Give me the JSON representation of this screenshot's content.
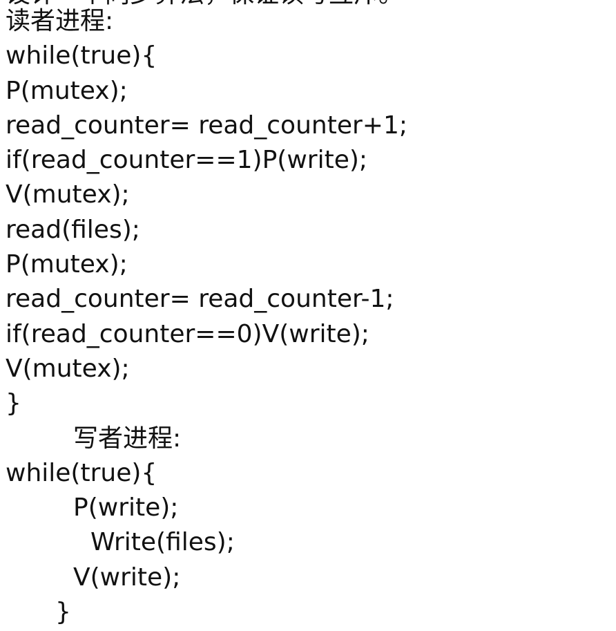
{
  "cut_off_header": "设计一个同步算法，保证读写互斥。",
  "reader": {
    "title": "读者进程:",
    "lines": [
      "while(true){",
      "P(mutex);",
      "read_counter= read_counter+1;",
      "if(read_counter==1)P(write);",
      "V(mutex);",
      "read(files);",
      "P(mutex);",
      "read_counter= read_counter-1;",
      "if(read_counter==0)V(write);",
      "V(mutex);",
      "}"
    ]
  },
  "writer": {
    "title": "写者进程:",
    "lines": [
      "while(true){",
      "P(write);",
      "Write(files);",
      "V(write);",
      "}"
    ]
  }
}
